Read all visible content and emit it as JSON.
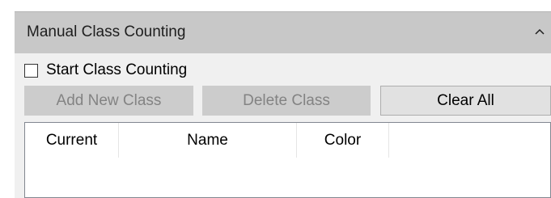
{
  "panel": {
    "title": "Manual Class Counting",
    "collapse_icon": "chevron-up-icon"
  },
  "checkbox": {
    "label": "Start Class Counting",
    "checked": false
  },
  "buttons": {
    "add_new_class": "Add New Class",
    "delete_class": "Delete Class",
    "clear_all": "Clear All"
  },
  "list": {
    "columns": [
      "Current",
      "Name",
      "Color"
    ],
    "rows": []
  },
  "colors": {
    "header_bg": "#c8c8c8",
    "panel_bg": "#f0f0f0",
    "disabled_button_bg": "#cccccc",
    "disabled_text": "#838383",
    "button_bg": "#e1e1e1",
    "list_border": "#828790"
  }
}
